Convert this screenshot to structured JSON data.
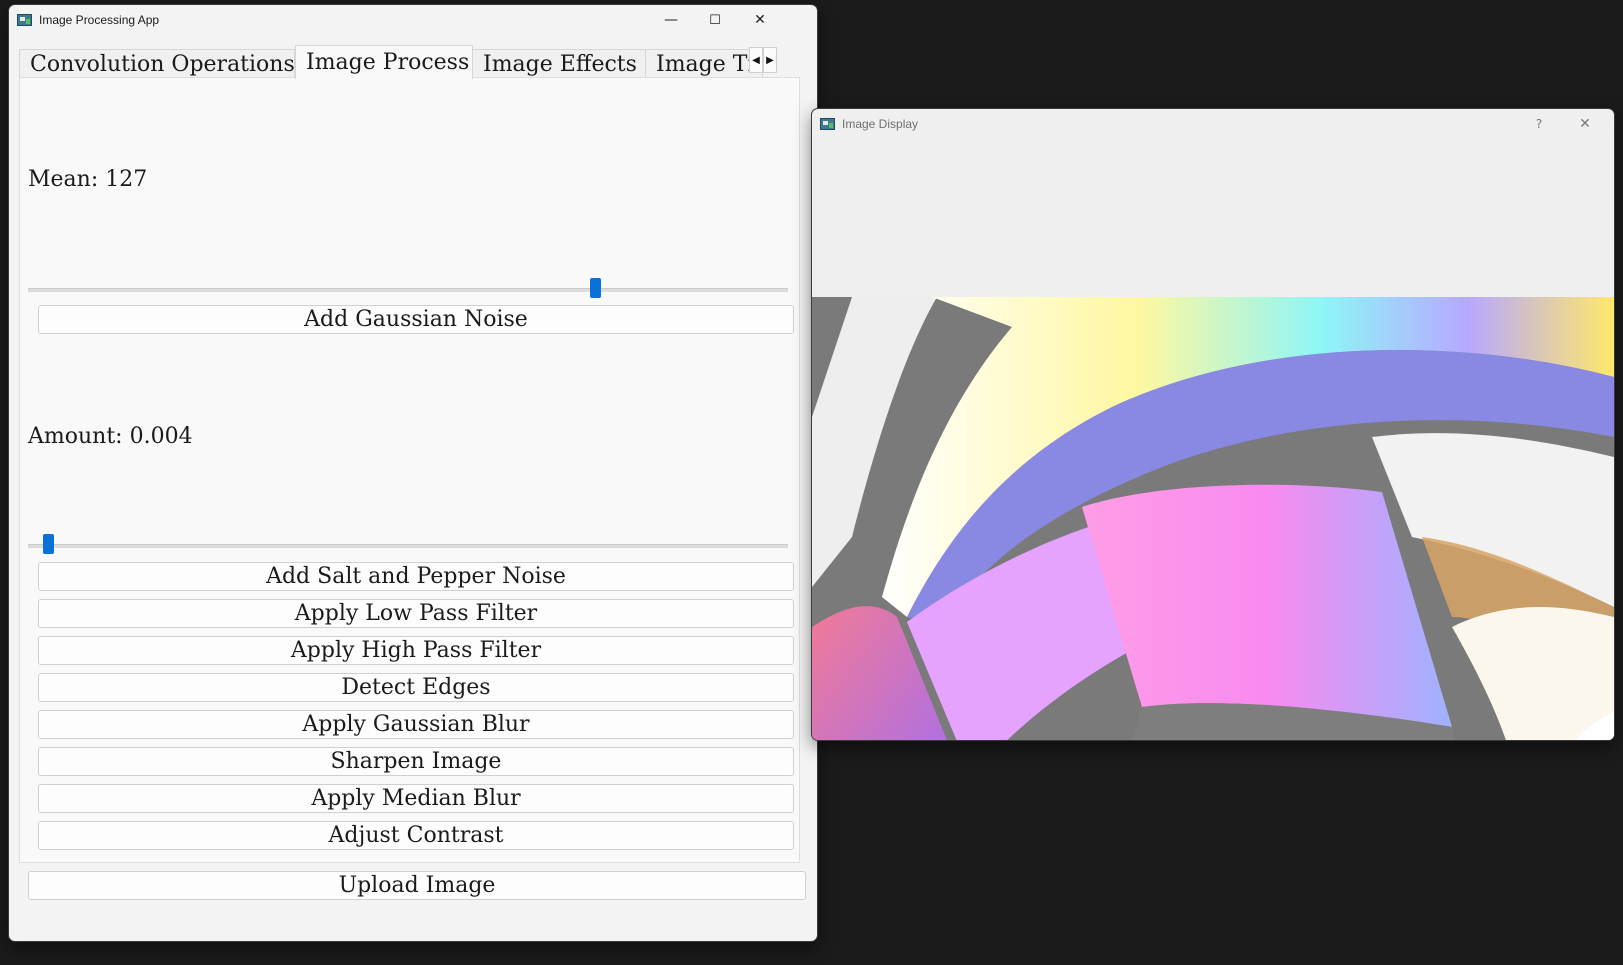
{
  "main_window": {
    "title": "Image Processing App",
    "controls": {
      "minimize": "—",
      "maximize": "☐",
      "close": "✕"
    },
    "tabs": [
      {
        "label": "Convolution Operations",
        "active": false
      },
      {
        "label": "Image Process",
        "active": true
      },
      {
        "label": "Image Effects",
        "active": false
      },
      {
        "label": "Image Tr",
        "active": false
      }
    ],
    "tab_scroll": {
      "left": "◀",
      "right": "▶"
    },
    "mean_label": "Mean: 127",
    "mean_slider_level": 0.75,
    "gaussian_button": "Add Gaussian Noise",
    "amount_label": "Amount: 0.004",
    "amount_slider_level": 0.02,
    "buttons": [
      "Add Salt and Pepper Noise",
      "Apply Low Pass Filter",
      "Apply High Pass Filter",
      "Detect Edges",
      "Apply Gaussian Blur",
      "Sharpen Image",
      "Apply Median Blur",
      "Adjust Contrast"
    ],
    "upload_button": "Upload Image"
  },
  "display_window": {
    "title": "Image Display",
    "controls": {
      "help": "?",
      "close": "✕"
    }
  },
  "colors": {
    "accent": "#0a72d6",
    "desktop": "#1b1b1b"
  }
}
